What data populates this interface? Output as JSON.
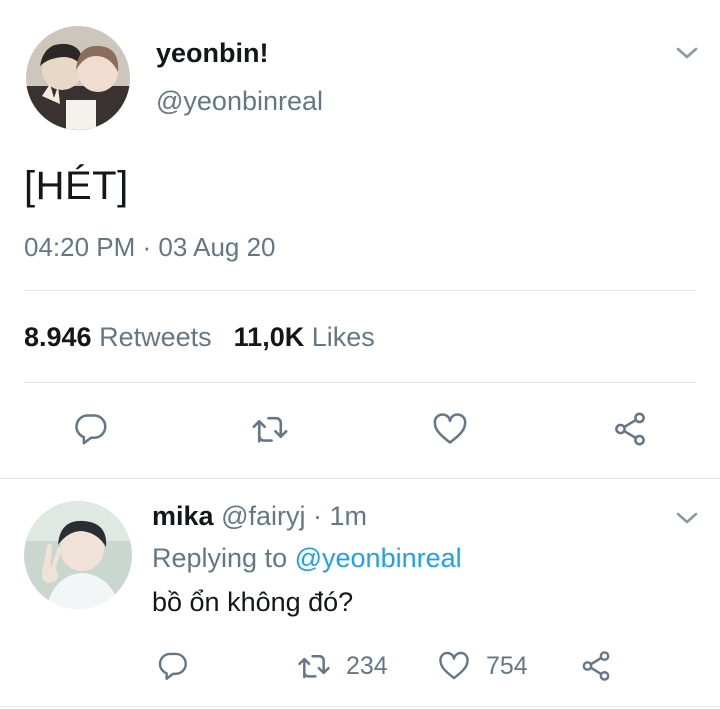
{
  "tweet": {
    "display_name": "yeonbin!",
    "handle": "@yeonbinreal",
    "text": "[HÉT]",
    "timestamp": "04:20 PM · 03 Aug 20",
    "retweets_count": "8.946",
    "retweets_label": "Retweets",
    "likes_count": "11,0K",
    "likes_label": "Likes"
  },
  "reply": {
    "display_name": "mika",
    "meta": "@fairyj · 1m",
    "replying_prefix": "Replying to",
    "replying_mention": "@yeonbinreal",
    "text": "bồ ổn không đó?",
    "retweets_count": "234",
    "likes_count": "754"
  },
  "icons": {
    "tweet_actions": [
      "reply-icon",
      "retweet-icon",
      "like-icon",
      "share-icon"
    ],
    "reply_actions": [
      "reply-icon",
      "retweet-icon",
      "like-icon",
      "share-icon"
    ]
  },
  "colors": {
    "primary_text": "#14171a",
    "secondary_text": "#657786",
    "accent": "#1da1f2",
    "icon": "#657786",
    "divider": "#e1e8ed"
  }
}
